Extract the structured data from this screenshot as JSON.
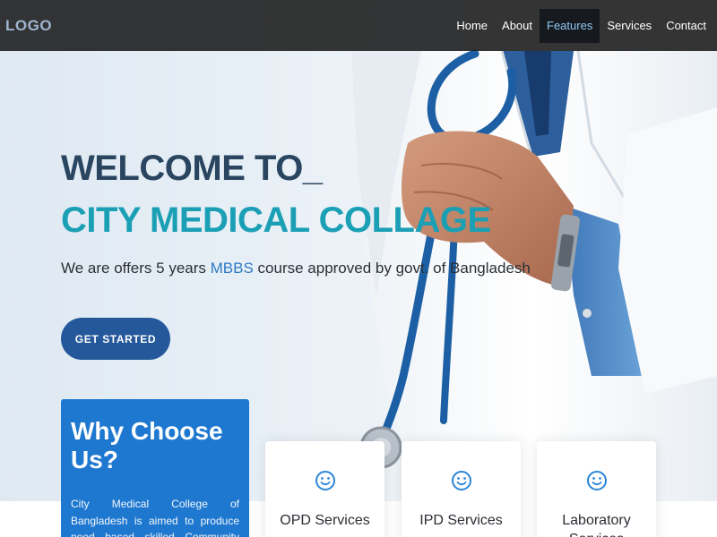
{
  "header": {
    "logo": "LOGO",
    "nav": [
      {
        "label": "Home",
        "active": false
      },
      {
        "label": "About",
        "active": false
      },
      {
        "label": "Features",
        "active": true
      },
      {
        "label": "Services",
        "active": false
      },
      {
        "label": "Contact",
        "active": false
      }
    ]
  },
  "hero": {
    "heading_line1": "WELCOME TO_",
    "heading_line2": "CITY MEDICAL COLLAGE",
    "tagline_prefix": "We are offers 5 years ",
    "tagline_highlight": "MBBS",
    "tagline_suffix": " course approved by govt. of Bangladesh",
    "cta_label": "GET STARTED"
  },
  "why": {
    "title": "Why Choose Us?",
    "text": "City Medical College of Bangladesh is aimed to produce need based skilled Community oriented doctors. Efforts will"
  },
  "services": [
    {
      "label": "OPD Services",
      "icon": "smiley-icon"
    },
    {
      "label": "IPD Services",
      "icon": "smiley-icon"
    },
    {
      "label": "Laboratory Services",
      "icon": "smiley-icon"
    }
  ],
  "colors": {
    "accent": "#24589b",
    "teal": "#1b9fb5",
    "why_bg": "#1f78cf"
  }
}
